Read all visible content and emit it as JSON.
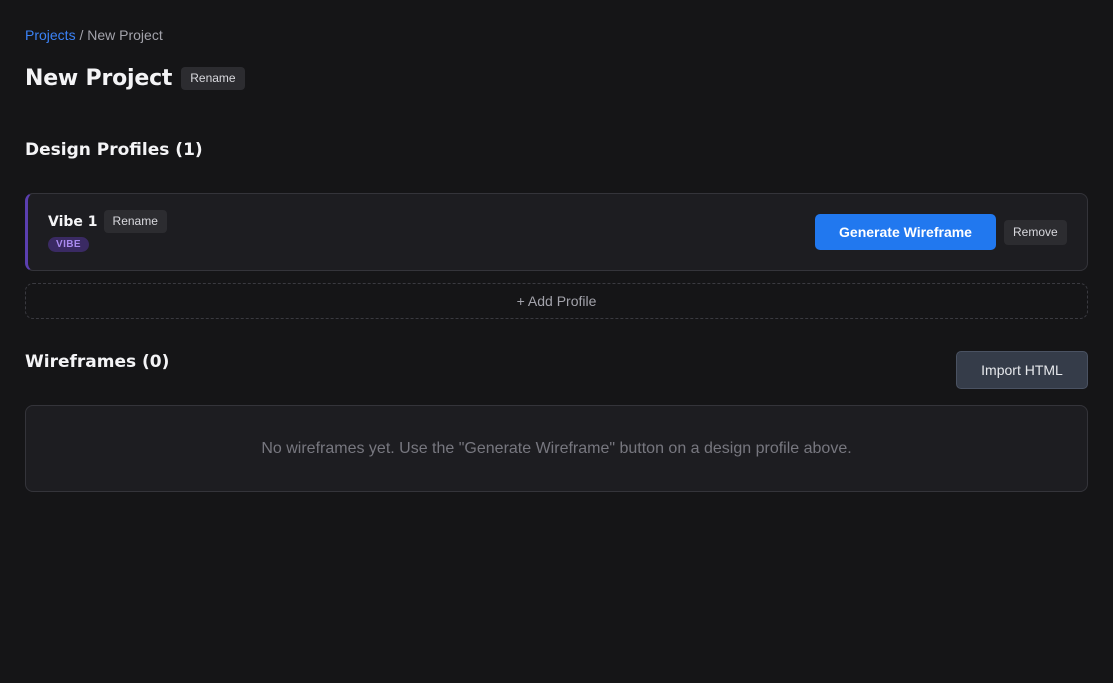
{
  "breadcrumb": {
    "root": "Projects",
    "separator": "/",
    "current": "New Project"
  },
  "header": {
    "title": "New Project",
    "rename_label": "Rename"
  },
  "design_profiles": {
    "heading": "Design Profiles (1)",
    "items": [
      {
        "name": "Vibe 1",
        "rename_label": "Rename",
        "badge": "VIBE",
        "generate_label": "Generate Wireframe",
        "remove_label": "Remove"
      }
    ],
    "add_label": "+ Add Profile"
  },
  "wireframes": {
    "heading": "Wireframes (0)",
    "import_label": "Import HTML",
    "empty_text": "No wireframes yet. Use the \"Generate Wireframe\" button on a design profile above."
  },
  "colors": {
    "background": "#151517",
    "accent_link": "#3b82f6",
    "primary_button": "#2178ef",
    "vibe_badge_bg": "#3a2a63",
    "vibe_badge_text": "#a98af0",
    "profile_accent_border": "#5b3fb0"
  }
}
